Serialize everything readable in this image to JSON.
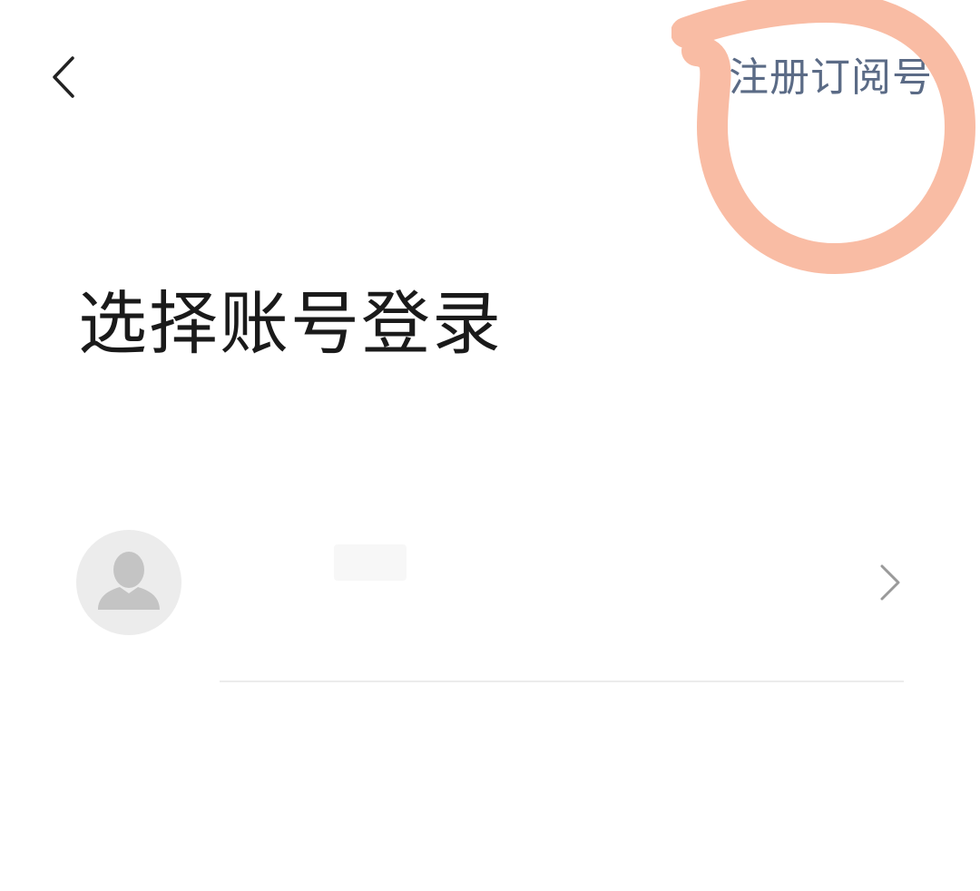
{
  "header": {
    "back_icon": "chevron-left-icon",
    "register_label": "注册订阅号"
  },
  "annotation": {
    "color": "#f9bca4"
  },
  "main": {
    "title": "选择账号登录",
    "accounts": [
      {
        "name": "",
        "avatar_icon": "person-avatar-icon",
        "chevron_icon": "chevron-right-icon"
      }
    ]
  }
}
